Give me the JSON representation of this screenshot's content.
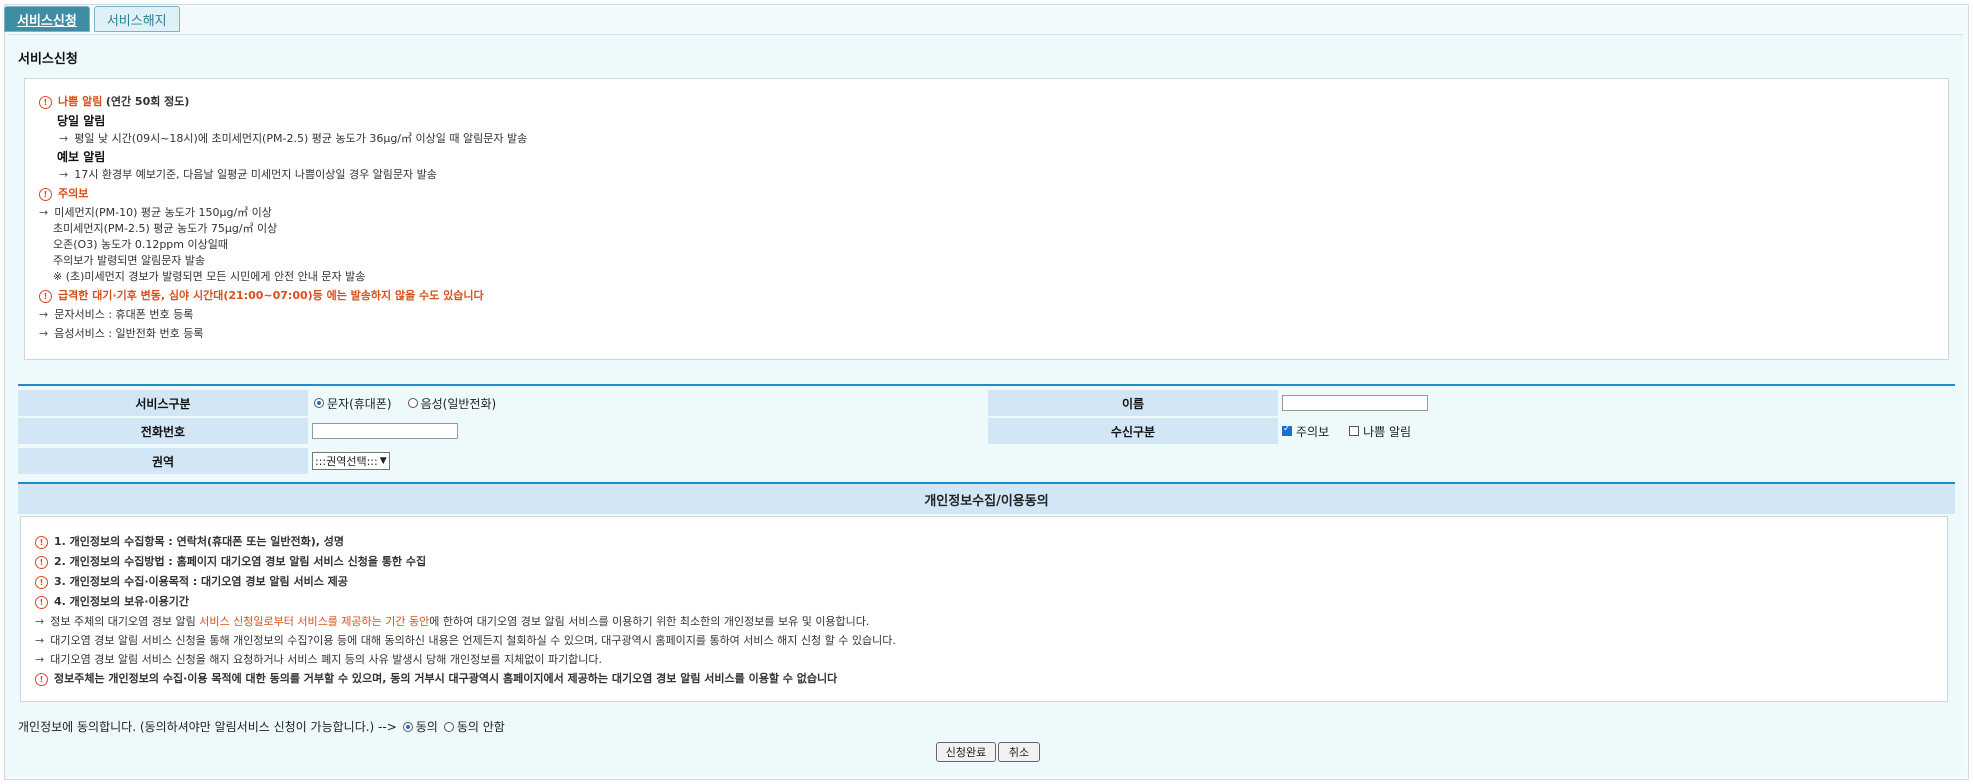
{
  "tabs": [
    {
      "label": "서비스신청"
    },
    {
      "label": "서비스해지"
    }
  ],
  "section_title": "서비스신청",
  "info": {
    "bad_title": "나쁨 알림",
    "bad_note": "(연간 50회 정도)",
    "today_title": "당일 알림",
    "today_desc": "평일 낮 시간(09시~18시)에 초미세먼지(PM-2.5) 평균 농도가 36μg/㎥ 이상일 때 알림문자 발송",
    "forecast_title": "예보 알림",
    "forecast_desc": "17시 환경부 예보기준, 다음날 일평균 미세먼지 나쁨이상일 경우 알림문자 발송",
    "watch_title": "주의보",
    "watch_lines": [
      "미세먼지(PM-10) 평균 농도가 150μg/㎥ 이상",
      "초미세먼지(PM-2.5) 평균 농도가 75μg/㎥ 이상",
      "오존(O3) 농도가 0.12ppm 이상일때",
      "주의보가 발령되면 알림문자 발송",
      "※ (초)미세먼지 경보가 발령되면 모든 시민에게 안전 안내 문자 발송"
    ],
    "notice": "급격한 대기·기후 변동, 심야 시간대(21:00~07:00)등 에는 발송하지 않을 수도 있습니다",
    "sms_service": "문자서비스 : 휴대폰 번호 등록",
    "voice_service": "음성서비스 : 일반전화 번호 등록"
  },
  "form": {
    "service_type_label": "서비스구분",
    "service_options": [
      "문자(휴대폰)",
      "음성(일반전화)"
    ],
    "name_label": "이름",
    "phone_label": "전화번호",
    "receive_label": "수신구분",
    "receive_options": [
      "주의보",
      "나쁨 알림"
    ],
    "region_label": "권역",
    "region_selected": ":::권역선택:::"
  },
  "consent": {
    "header": "개인정보수집/이용동의",
    "items": [
      "1. 개인정보의 수집항목 : 연락처(휴대폰 또는 일반전화), 성명",
      "2. 개인정보의 수집방법 : 홈페이지 대기오염 경보 알림 서비스 신청을 통한 수집",
      "3. 개인정보의 수집·이용목적 : 대기오염 경보 알림 서비스 제공",
      "4. 개인정보의 보유·이용기간"
    ],
    "period_pre": "정보 주체의 대기오염 경보 알림 ",
    "period_hl": "서비스 신청일로부터 서비스를 제공하는 기간 동안",
    "period_post": "에 한하여 대기오염 경보 알림 서비스를 이용하기 위한 최소한의 개인정보를 보유 및 이용합니다.",
    "line2": "대기오염 경보 알림 서비스 신청을 통해 개인정보의 수집?이용 등에 대해 동의하신 내용은 언제든지 철회하실 수 있으며, 대구광역시 홈페이지를 통하여 서비스 해지 신청 할 수 있습니다.",
    "line3": "대기오염 경보 알림 서비스 신청을 해지 요청하거나 서비스 폐지 등의 사유 발생시 당해 개인정보를 지체없이 파기합니다.",
    "refuse": "정보주체는 개인정보의 수집·이용 목적에 대한 동의를 거부할 수 있으며, 동의 거부시 대구광역시 홈페이지에서 제공하는 대기오염 경보 알림 서비스를 이용할 수 없습니다"
  },
  "agree": {
    "text": "개인정보에 동의합니다. (동의하셔야만 알림서비스 신청이 가능합니다.) -->",
    "yes": "동의",
    "no": "동의 안함"
  },
  "buttons": {
    "submit": "신청완료",
    "cancel": "취소"
  }
}
